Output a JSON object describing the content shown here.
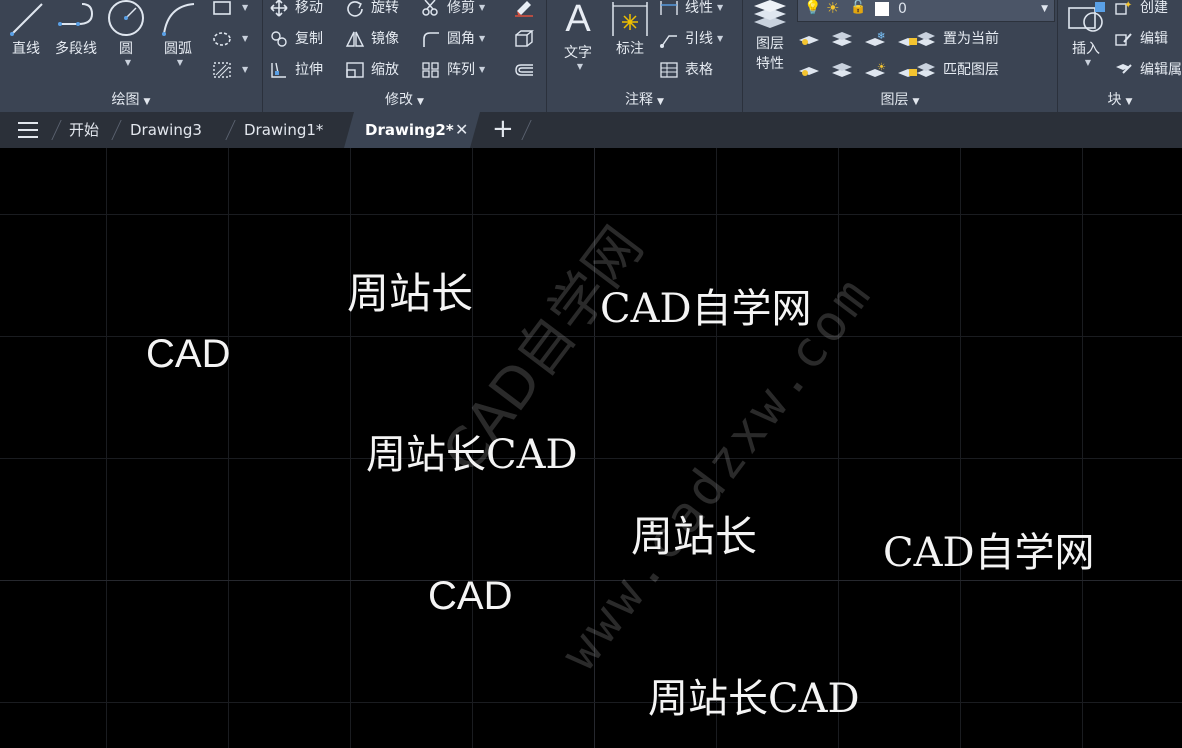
{
  "ribbon": {
    "draw": {
      "title": "绘图",
      "line": "直线",
      "polyline": "多段线",
      "circle": "圆",
      "arc": "圆弧"
    },
    "modify": {
      "title": "修改",
      "move": "移动",
      "rotate": "旋转",
      "trim": "修剪",
      "copy": "复制",
      "mirror": "镜像",
      "fillet": "圆角",
      "stretch": "拉伸",
      "scale": "缩放",
      "array": "阵列"
    },
    "annotation": {
      "title": "注释",
      "text": "文字",
      "dimension": "标注",
      "linear": "线性",
      "leader": "引线",
      "table": "表格"
    },
    "layers": {
      "title": "图层",
      "layer_properties_line1": "图层",
      "layer_properties_line2": "特性",
      "current_layer": "0",
      "make_current": "置为当前",
      "match_layer": "匹配图层"
    },
    "block": {
      "title": "块",
      "insert": "插入",
      "create": "创建",
      "edit": "编辑",
      "edit_attributes": "编辑属"
    }
  },
  "tabs": {
    "start": "开始",
    "items": [
      "Drawing3",
      "Drawing1*",
      "Drawing2*"
    ],
    "active": "Drawing2*"
  },
  "canvas": {
    "texts": [
      "周站长",
      "CAD自学网",
      "CAD",
      "周站长CAD",
      "周站长",
      "CAD自学网",
      "CAD",
      "周站长CAD"
    ],
    "watermark_line1": "CAD自学网",
    "watermark_line2": "www.cadzxw.com"
  },
  "colors": {
    "ribbon_bg": "#3b4453",
    "tabbar_bg": "#2b3039",
    "canvas_bg": "#000000",
    "grid": "#1a1c20",
    "text": "#f4f4f4"
  }
}
